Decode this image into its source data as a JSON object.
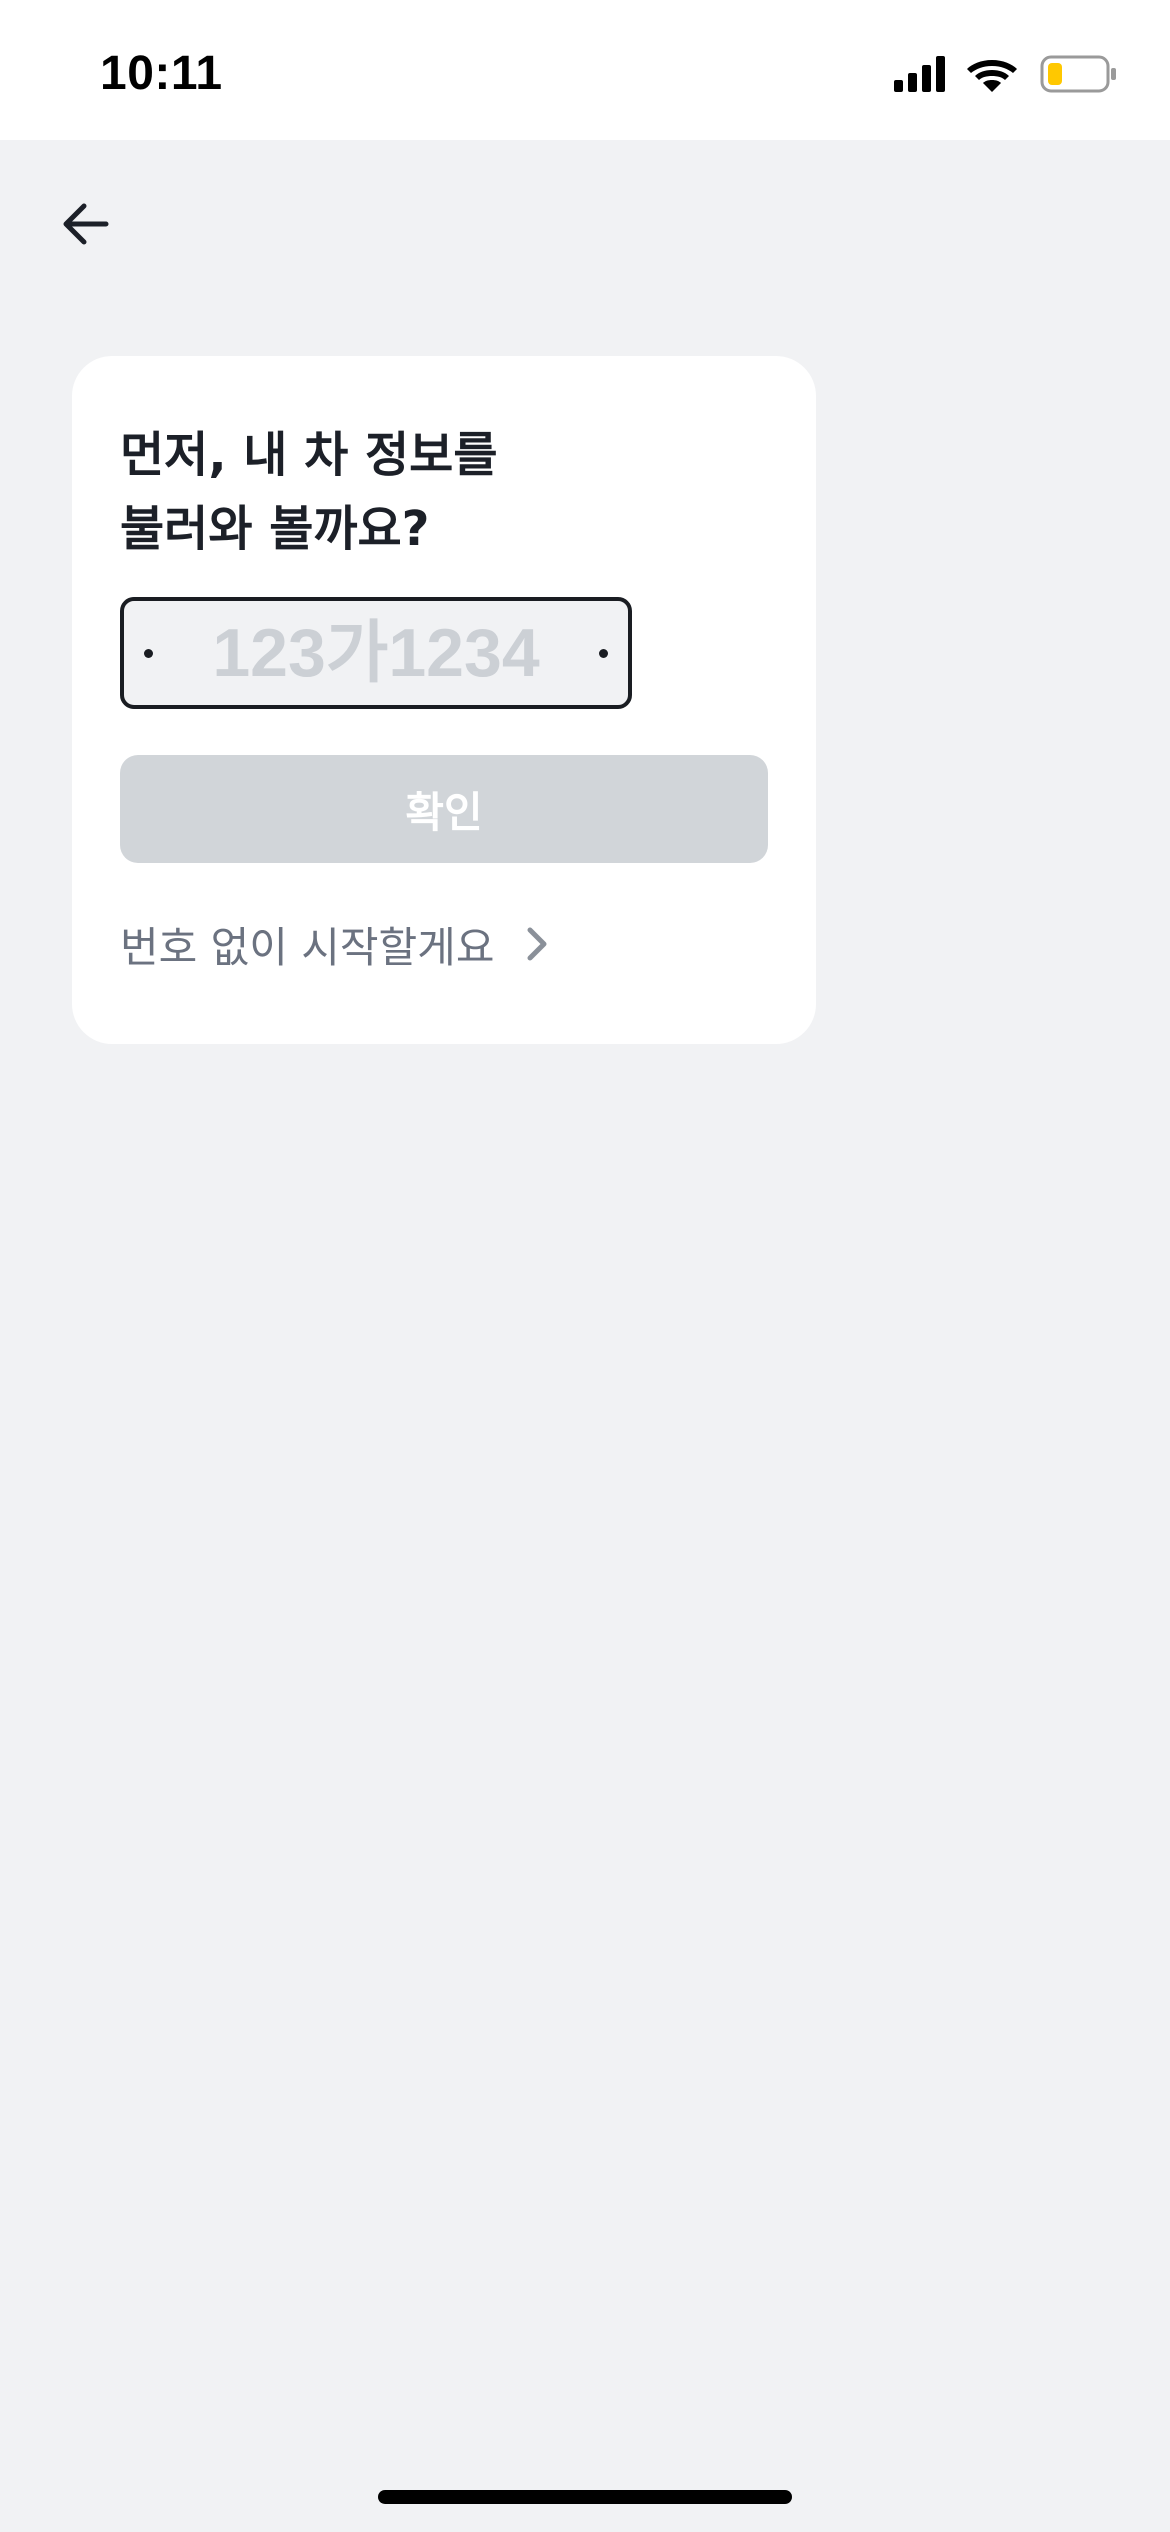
{
  "status_bar": {
    "time": "10:11",
    "icons": [
      "signal-icon",
      "wifi-icon",
      "battery-icon"
    ],
    "battery_color": "#ffc800"
  },
  "nav": {
    "back_icon": "arrow-left-icon"
  },
  "card": {
    "title_line1": "먼저, 내 차 정보를",
    "title_line2": "불러와 볼까요?",
    "plate_input": {
      "value": "",
      "placeholder": "123가1234"
    },
    "confirm_label": "확인",
    "skip_label": "번호 없이 시작할게요",
    "skip_icon": "chevron-right-icon"
  },
  "colors": {
    "background": "#f1f2f4",
    "card": "#ffffff",
    "disabled_button": "#d1d5d9",
    "secondary_text": "#6b7280"
  }
}
